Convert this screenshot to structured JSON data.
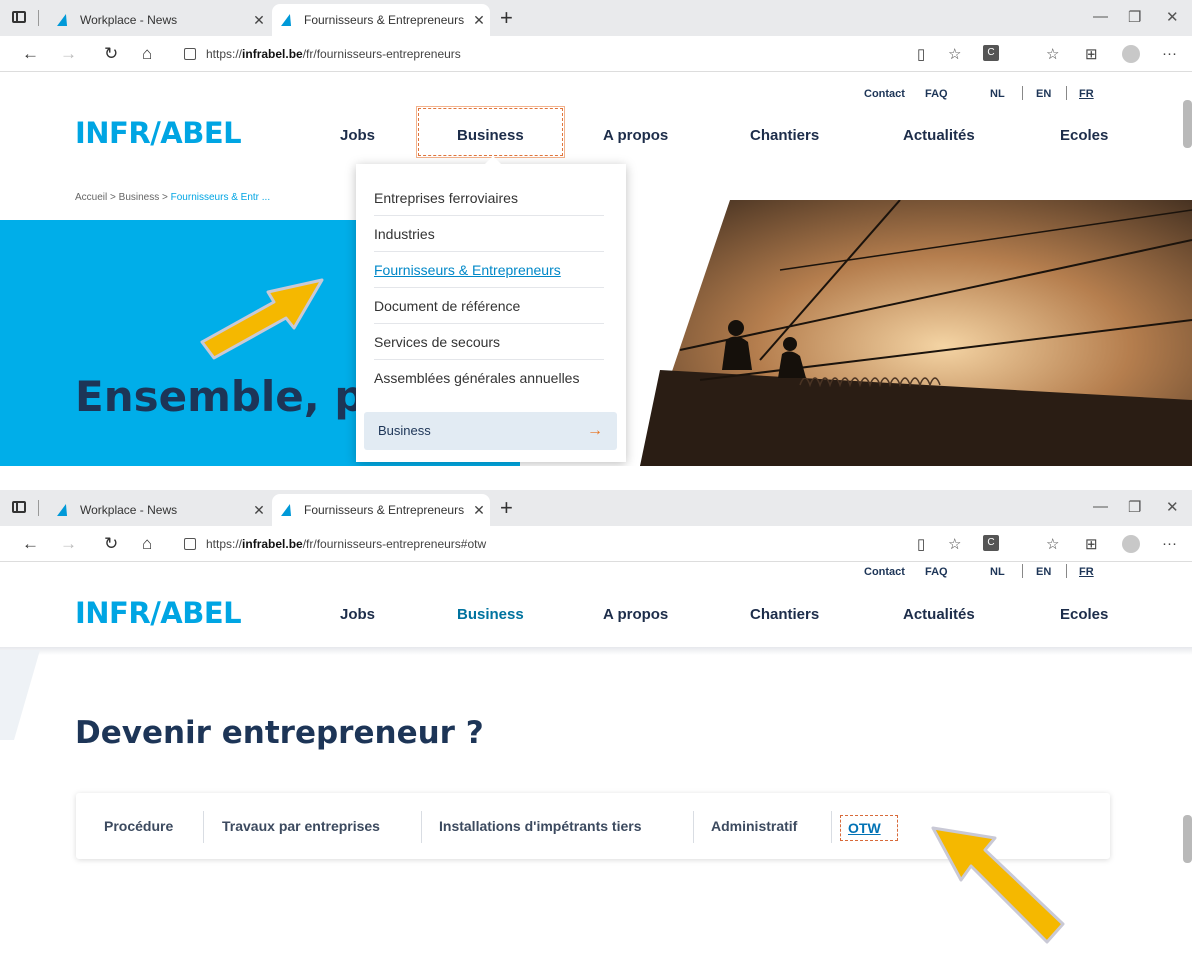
{
  "browser": {
    "tab_inactive": "Workplace - News",
    "tab_active": "Fournisseurs & Entrepreneurs Inf",
    "url1": {
      "prefix": "https://",
      "domain": "infrabel.be",
      "path": "/fr/fournisseurs-entrepreneurs"
    },
    "url2": {
      "prefix": "https://",
      "domain": "infrabel.be",
      "path": "/fr/fournisseurs-entrepreneurs#otw"
    },
    "ext_label": "C"
  },
  "site": {
    "logo": "INFR/ABEL",
    "util_links": [
      "Contact",
      "FAQ"
    ],
    "languages": [
      "NL",
      "EN",
      "FR"
    ],
    "nav": [
      "Jobs",
      "Business",
      "A propos",
      "Chantiers",
      "Actualités",
      "Ecoles"
    ]
  },
  "screen1": {
    "breadcrumb": [
      "Accueil",
      "Business",
      "Fournisseurs & Entr ..."
    ],
    "hero_title": "Ensemble, pl",
    "dropdown_items": [
      "Entreprises ferroviaires",
      "Industries",
      "Fournisseurs & Entrepreneurs",
      "Document de référence",
      "Services de secours",
      "Assemblées générales annuelles"
    ],
    "dropdown_current_index": 2,
    "dropdown_footer": "Business"
  },
  "screen2": {
    "heading": "Devenir entrepreneur ?",
    "tabs": [
      "Procédure",
      "Travaux par entreprises",
      "Installations d'impétrants tiers",
      "Administratif",
      "OTW"
    ]
  },
  "colors": {
    "brand_blue": "#00aee9",
    "navy": "#1d3557",
    "highlight": "#f5b800",
    "accent": "#e8731f"
  },
  "icons": [
    "tab-actions-icon",
    "infrabel-favicon",
    "back-arrow-icon",
    "forward-arrow-icon",
    "reload-icon",
    "home-icon",
    "lock-icon",
    "reader-view-icon",
    "favorite-star-icon",
    "extension-icon",
    "favorites-list-icon",
    "collections-icon",
    "profile-icon",
    "more-icon",
    "minimize-icon",
    "maximize-icon",
    "close-icon",
    "arrow-right-icon"
  ]
}
